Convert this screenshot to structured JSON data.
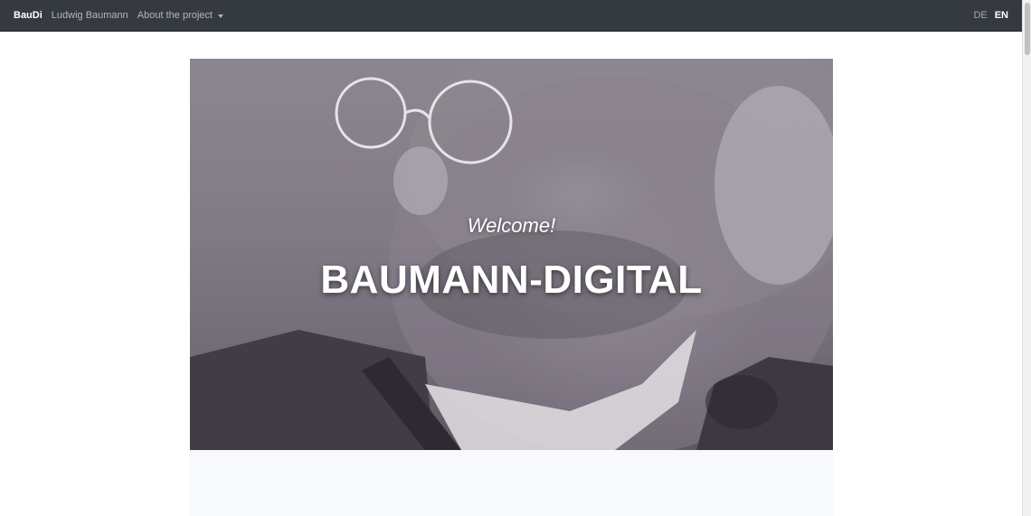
{
  "navbar": {
    "brand": "BauDi",
    "items": [
      {
        "label": "Ludwig Baumann"
      },
      {
        "label": "About the project"
      }
    ],
    "languages": [
      "DE",
      "EN"
    ],
    "active_language": "EN",
    "colors": {
      "background": "#343a40",
      "text": "#ffffff"
    }
  },
  "hero": {
    "welcome": "Welcome!",
    "title": "BAUMANN-DIGITAL"
  },
  "icons": {
    "dropdown": "caret-down-icon"
  }
}
